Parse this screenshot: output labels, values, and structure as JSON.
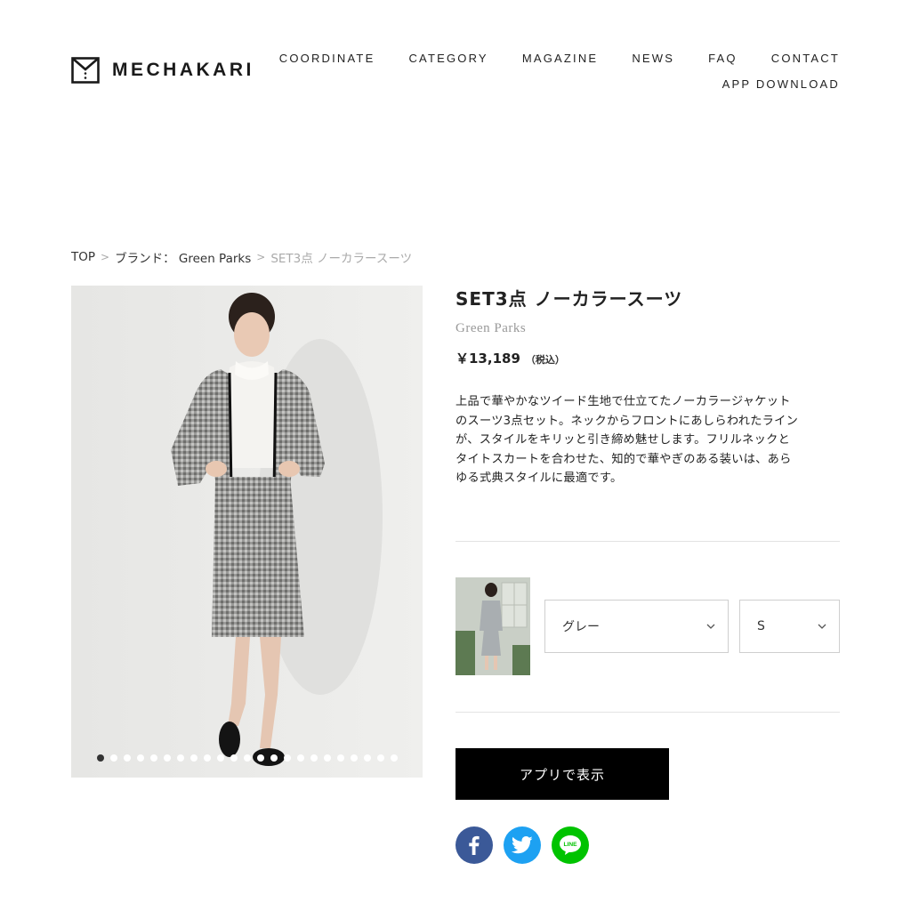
{
  "header": {
    "logo_text": "MECHAKARI",
    "nav_row1": [
      "COORDINATE",
      "CATEGORY",
      "MAGAZINE",
      "NEWS",
      "FAQ",
      "CONTACT"
    ],
    "nav_row2": [
      "APP DOWNLOAD"
    ]
  },
  "breadcrumb": {
    "items": [
      "TOP",
      "ブランド： Green Parks"
    ],
    "current": "SET3点 ノーカラースーツ",
    "separator": ">"
  },
  "gallery": {
    "dot_count": 23,
    "active_index": 0
  },
  "product": {
    "title": "SET3点 ノーカラースーツ",
    "brand": "Green Parks",
    "price": "￥13,189",
    "tax_note": "（税込）",
    "description": [
      "上品で華やかなツイード生地で仕立てたノーカラージャケット",
      "のスーツ3点セット。ネックからフロントにあしらわれたライン",
      "が、スタイルをキリッと引き締め魅せします。フリルネックと",
      "タイトスカートを合わせた、知的で華やぎのある装いは、あら",
      "ゆる式典スタイルに最適です。"
    ]
  },
  "variant": {
    "color_selected": "グレー",
    "size_selected": "S"
  },
  "actions": {
    "app_button_label": "アプリで表示"
  },
  "share": {
    "facebook_color": "#3b5998",
    "twitter_color": "#1da1f2",
    "line_color": "#00c300",
    "line_label": "LINE"
  }
}
